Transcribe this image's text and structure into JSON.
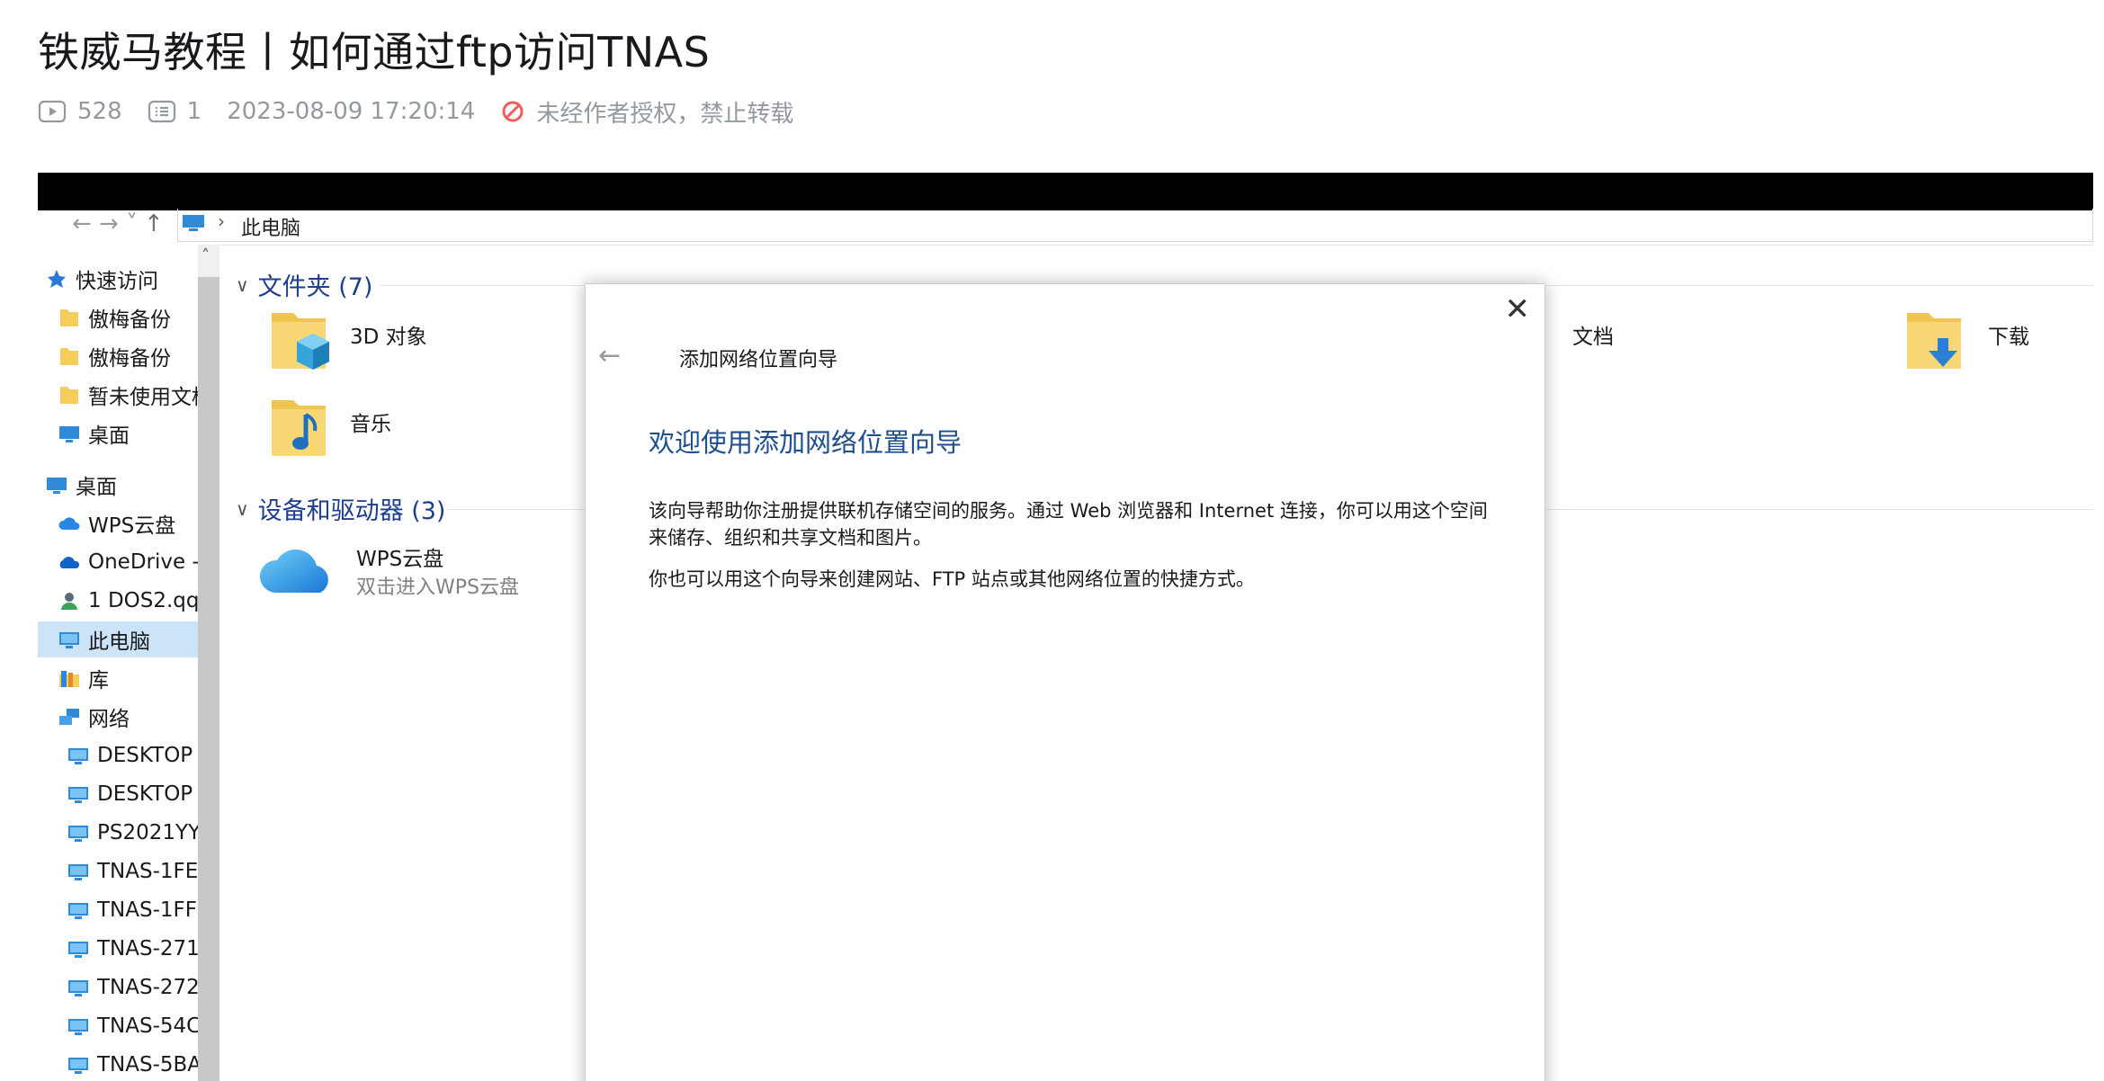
{
  "page": {
    "title": "铁威马教程丨如何通过ftp访问TNAS",
    "views": "528",
    "comments": "1",
    "datetime": "2023-08-09 17:20:14",
    "copyright_notice": "未经作者授权，禁止转载"
  },
  "explorer": {
    "address": {
      "nav_arrows": "← → ˅",
      "up": "↑",
      "separator": "›",
      "path": "此电脑"
    },
    "sidebar": {
      "items": [
        {
          "label": "快速访问",
          "icon": "pin-icon"
        },
        {
          "label": "傲梅备份",
          "icon": "folder-icon"
        },
        {
          "label": "傲梅备份",
          "icon": "folder-icon"
        },
        {
          "label": "暂未使用文档",
          "icon": "folder-icon"
        },
        {
          "label": "桌面",
          "icon": "desktop-icon"
        },
        {
          "label": "桌面",
          "icon": "desktop-icon"
        },
        {
          "label": "WPS云盘",
          "icon": "cloud-icon"
        },
        {
          "label": "OneDrive - ",
          "icon": "onedrive-icon"
        },
        {
          "label": "1 DOS2.qq",
          "icon": "user-icon"
        },
        {
          "label": "此电脑",
          "icon": "computer-icon"
        },
        {
          "label": "库",
          "icon": "library-icon"
        },
        {
          "label": "网络",
          "icon": "network-icon"
        },
        {
          "label": "DESKTOP",
          "icon": "computer-icon"
        },
        {
          "label": "DESKTOP",
          "icon": "computer-icon"
        },
        {
          "label": "PS2021YY",
          "icon": "computer-icon"
        },
        {
          "label": "TNAS-1FE",
          "icon": "computer-icon"
        },
        {
          "label": "TNAS-1FF",
          "icon": "computer-icon"
        },
        {
          "label": "TNAS-271",
          "icon": "computer-icon"
        },
        {
          "label": "TNAS-272",
          "icon": "computer-icon"
        },
        {
          "label": "TNAS-54C",
          "icon": "computer-icon"
        },
        {
          "label": "TNAS-5BA",
          "icon": "computer-icon"
        }
      ],
      "scroll_up": "˄"
    },
    "folders_group": {
      "header": "文件夹 (7)",
      "items": [
        {
          "label": "3D 对象",
          "icon": "3d-objects-folder-icon"
        },
        {
          "label": "音乐",
          "icon": "music-folder-icon"
        },
        {
          "label": "文档",
          "icon": "documents-folder-icon"
        },
        {
          "label": "下载",
          "icon": "downloads-folder-icon"
        }
      ]
    },
    "drives_group": {
      "header": "设备和驱动器 (3)",
      "items": [
        {
          "label": "WPS云盘",
          "sublabel": "双击进入WPS云盘",
          "icon": "wps-cloud-icon"
        }
      ]
    }
  },
  "wizard": {
    "close": "✕",
    "back": "←",
    "window_title": "添加网络位置向导",
    "heading": "欢迎使用添加网络位置向导",
    "paragraph1": "该向导帮助你注册提供联机存储空间的服务。通过 Web 浏览器和 Internet 连接，你可以用这个空间来储存、组织和共享文档和图片。",
    "paragraph2": "你也可以用这个向导来创建网站、FTP 站点或其他网络位置的快捷方式。"
  },
  "colors": {
    "heading_blue": "#1e4e8c",
    "group_blue": "#1e3d8f",
    "selection": "#cce4f7",
    "meta_grey": "#9499a0",
    "warn_red": "#f25d59"
  }
}
